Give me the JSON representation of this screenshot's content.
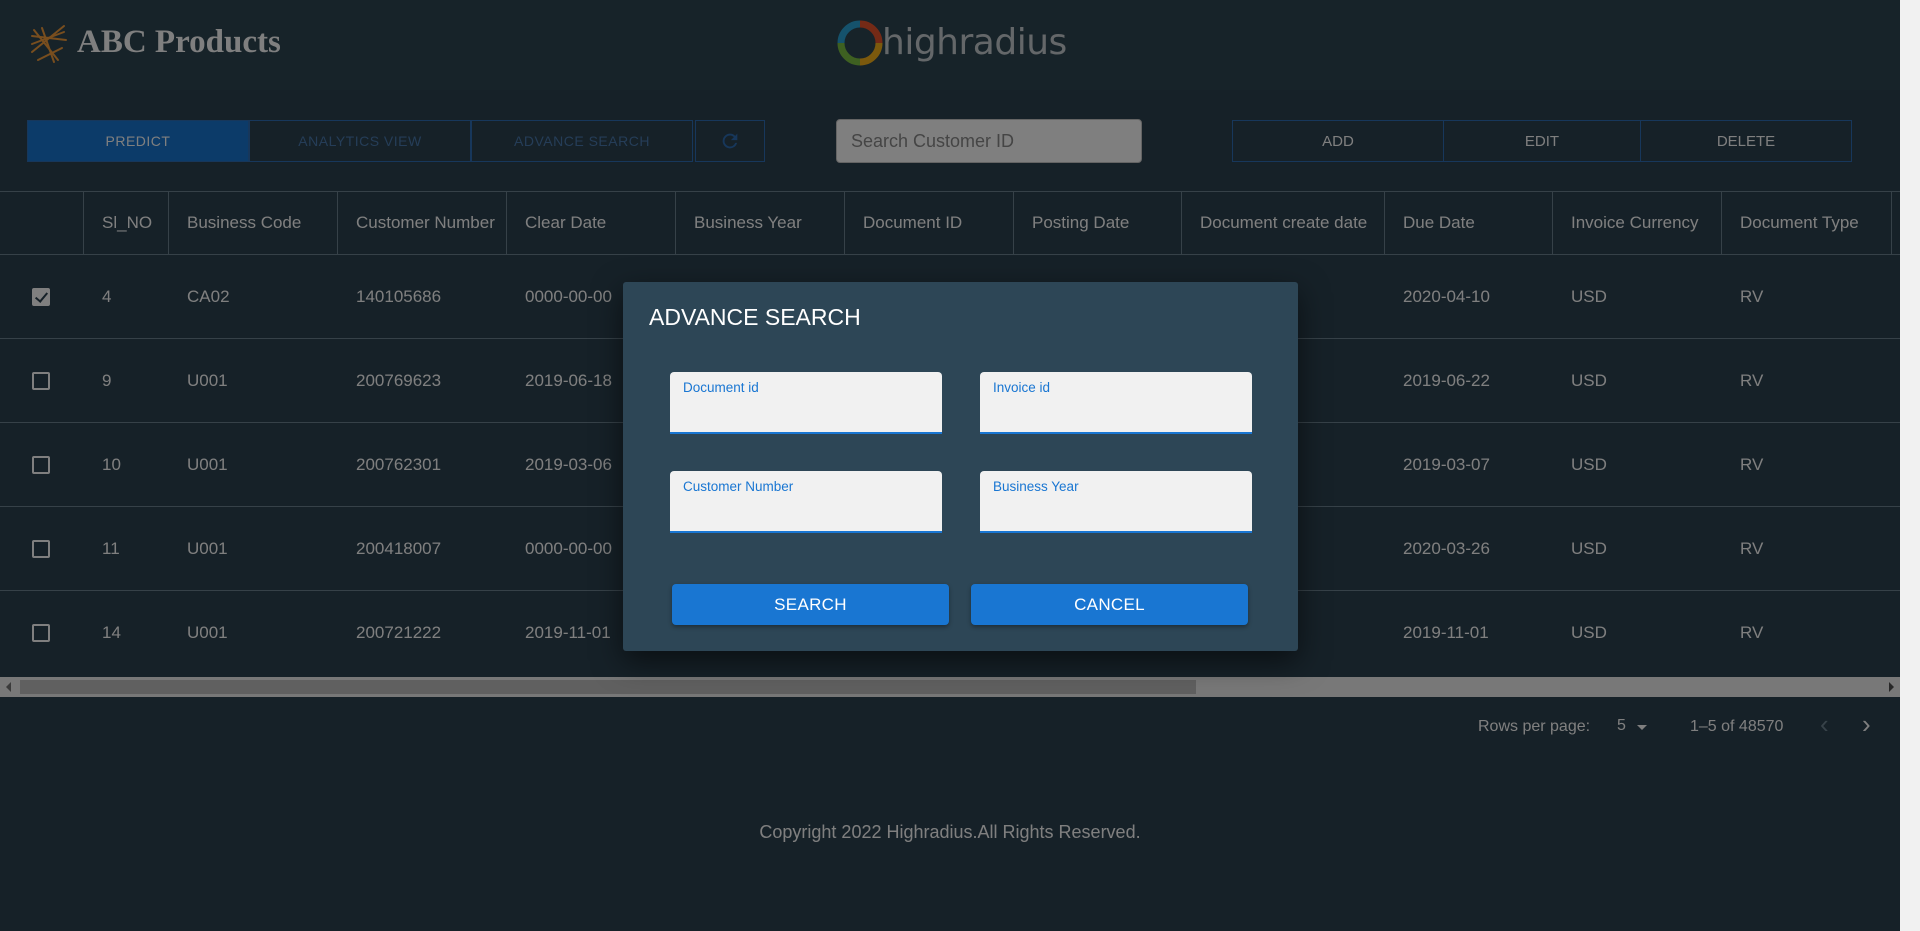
{
  "header": {
    "app_title": "ABC Products",
    "brand_text": "highradius"
  },
  "toolbar": {
    "tabs": [
      {
        "label": "PREDICT",
        "active": true
      },
      {
        "label": "ANALYTICS VIEW",
        "active": false
      },
      {
        "label": "ADVANCE SEARCH",
        "active": false
      }
    ],
    "refresh_icon": "refresh-icon",
    "search_placeholder": "Search Customer ID",
    "actions": [
      {
        "label": "ADD"
      },
      {
        "label": "EDIT"
      },
      {
        "label": "DELETE"
      }
    ]
  },
  "table": {
    "columns": [
      "Sl_NO",
      "Business Code",
      "Customer Number",
      "Clear Date",
      "Business Year",
      "Document ID",
      "Posting Date",
      "Document create date",
      "Due Date",
      "Invoice Currency",
      "Document Type"
    ],
    "rows": [
      {
        "checked": true,
        "sl_no": "4",
        "business_code": "CA02",
        "customer_number": "140105686",
        "clear_date": "0000-00-00",
        "due_date": "2020-04-10",
        "invoice_currency": "USD",
        "document_type": "RV"
      },
      {
        "checked": false,
        "sl_no": "9",
        "business_code": "U001",
        "customer_number": "200769623",
        "clear_date": "2019-06-18",
        "due_date": "2019-06-22",
        "invoice_currency": "USD",
        "document_type": "RV"
      },
      {
        "checked": false,
        "sl_no": "10",
        "business_code": "U001",
        "customer_number": "200762301",
        "clear_date": "2019-03-06",
        "due_date": "2019-03-07",
        "invoice_currency": "USD",
        "document_type": "RV"
      },
      {
        "checked": false,
        "sl_no": "11",
        "business_code": "U001",
        "customer_number": "200418007",
        "clear_date": "0000-00-00",
        "due_date": "2020-03-26",
        "invoice_currency": "USD",
        "document_type": "RV"
      },
      {
        "checked": false,
        "sl_no": "14",
        "business_code": "U001",
        "customer_number": "200721222",
        "clear_date": "2019-11-01",
        "due_date": "2019-11-01",
        "invoice_currency": "USD",
        "document_type": "RV"
      }
    ]
  },
  "pagination": {
    "rows_per_page_label": "Rows per page:",
    "rows_per_page_value": "5",
    "range_text": "1–5 of 48570"
  },
  "footer": {
    "copyright": "Copyright 2022 Highradius.All Rights Reserved."
  },
  "modal": {
    "title": "ADVANCE SEARCH",
    "fields": [
      {
        "label": "Document id",
        "value": ""
      },
      {
        "label": "Invoice id",
        "value": ""
      },
      {
        "label": "Customer Number",
        "value": ""
      },
      {
        "label": "Business Year",
        "value": ""
      }
    ],
    "search_button": "SEARCH",
    "cancel_button": "CANCEL"
  },
  "colors": {
    "background": "#2c4250",
    "primary": "#1976d2",
    "modal_bg": "#2d4656"
  }
}
